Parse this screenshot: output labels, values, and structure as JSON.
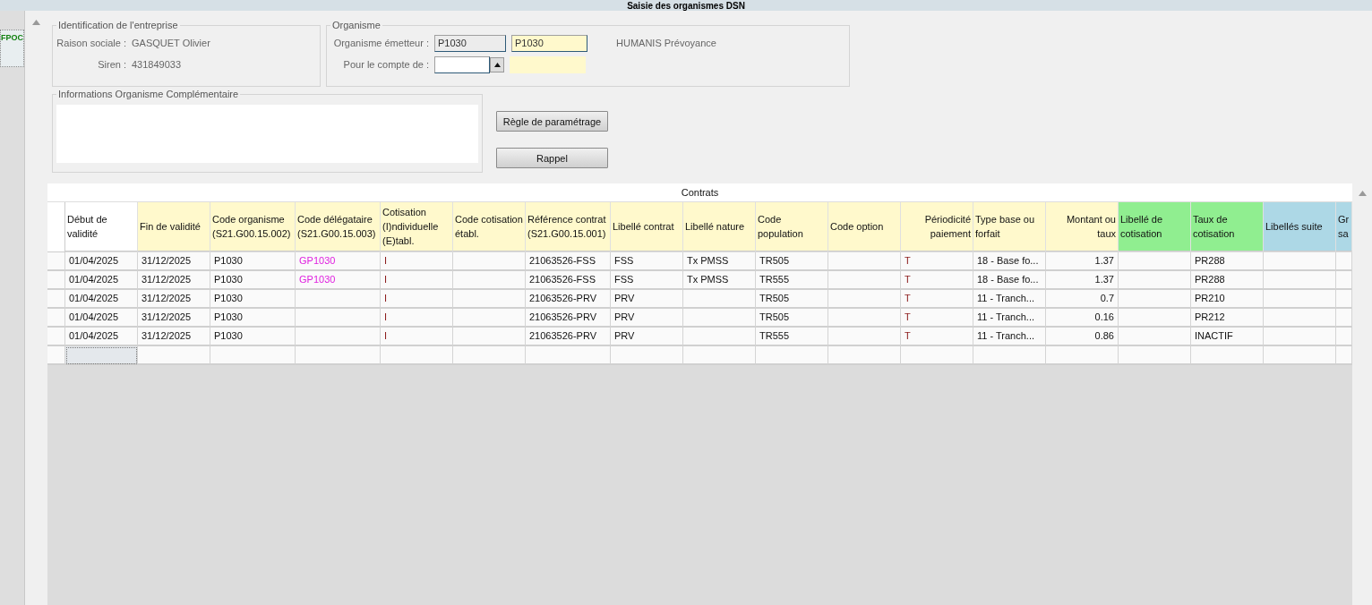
{
  "window": {
    "title": "Saisie des organismes DSN"
  },
  "sidebar": {
    "tab": "FPOC"
  },
  "identification": {
    "legend": "Identification de l'entreprise",
    "fields": [
      {
        "label": "Raison sociale :",
        "value": "GASQUET Olivier"
      },
      {
        "label": "Siren :",
        "value": "431849033"
      }
    ]
  },
  "organisme": {
    "legend": "Organisme",
    "emetteur_label": "Organisme émetteur :",
    "emetteur_code": "P1030",
    "emetteur_value": "P1030",
    "emetteur_name": "HUMANIS Prévoyance",
    "compte_label": "Pour le compte de :"
  },
  "informations": {
    "legend": "Informations Organisme Complémentaire"
  },
  "buttons": [
    "Règle de paramétrage",
    "Rappel"
  ],
  "table": {
    "title": "Contrats",
    "columns": [
      {
        "label": "Début de validité",
        "color": "#ffffff"
      },
      {
        "label": "Fin de validité",
        "color": "#fff9cc"
      },
      {
        "label": "Code organisme (S21.G00.15.002)",
        "color": "#fff9cc"
      },
      {
        "label": "Code délégataire (S21.G00.15.003)",
        "color": "#fff9cc"
      },
      {
        "label": "Cotisation (I)ndividuelle (E)tabl.",
        "color": "#fff9cc"
      },
      {
        "label": "Code cotisation établ.",
        "color": "#fff9cc"
      },
      {
        "label": "Référence contrat (S21.G00.15.001)",
        "color": "#fff9cc"
      },
      {
        "label": "Libellé contrat",
        "color": "#fff9cc"
      },
      {
        "label": "Libellé nature",
        "color": "#fff9cc"
      },
      {
        "label": "Code population",
        "color": "#fff9cc"
      },
      {
        "label": "Code option",
        "color": "#fff9cc"
      },
      {
        "label": "Périodicité paiement",
        "color": "#fff9cc"
      },
      {
        "label": "Type base ou forfait",
        "color": "#fff9cc"
      },
      {
        "label": "Montant ou taux",
        "color": "#fff9cc"
      },
      {
        "label": "Libellé de cotisation",
        "color": "#90ee90"
      },
      {
        "label": "Taux de cotisation",
        "color": "#90ee90"
      },
      {
        "label": "Libellés suite",
        "color": "#add8e6"
      },
      {
        "label": "Gr sa",
        "color": "#add8e6"
      }
    ],
    "rows": [
      {
        "cells": [
          "01/04/2025",
          "31/12/2025",
          "P1030",
          "GP1030",
          "I",
          "",
          "21063526-FSS",
          "FSS",
          "Tx PMSS",
          "TR505",
          "",
          "T",
          "18 - Base fo...",
          "1.37",
          "",
          "PR288",
          "",
          ""
        ]
      },
      {
        "cells": [
          "01/04/2025",
          "31/12/2025",
          "P1030",
          "GP1030",
          "I",
          "",
          "21063526-FSS",
          "FSS",
          "Tx PMSS",
          "TR555",
          "",
          "T",
          "18 - Base fo...",
          "1.37",
          "",
          "PR288",
          "",
          ""
        ]
      },
      {
        "cells": [
          "01/04/2025",
          "31/12/2025",
          "P1030",
          "",
          "I",
          "",
          "21063526-PRV",
          "PRV",
          "",
          "TR505",
          "",
          "T",
          "11 - Tranch...",
          "0.7",
          "",
          "PR210",
          "",
          ""
        ]
      },
      {
        "cells": [
          "01/04/2025",
          "31/12/2025",
          "P1030",
          "",
          "I",
          "",
          "21063526-PRV",
          "PRV",
          "",
          "TR505",
          "",
          "T",
          "11 - Tranch...",
          "0.16",
          "",
          "PR212",
          "",
          ""
        ]
      },
      {
        "cells": [
          "01/04/2025",
          "31/12/2025",
          "P1030",
          "",
          "I",
          "",
          "21063526-PRV",
          "PRV",
          "",
          "TR555",
          "",
          "T",
          "11 - Tranch...",
          "0.86",
          "",
          "INACTIF",
          "",
          ""
        ]
      }
    ],
    "blank_row": {
      "focused": true
    }
  }
}
